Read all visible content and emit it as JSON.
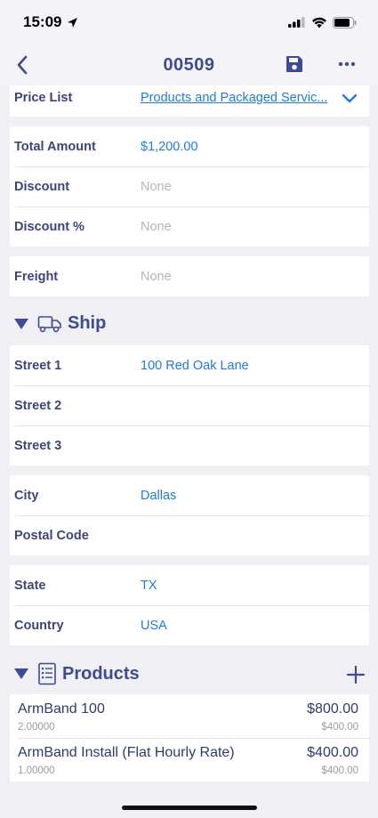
{
  "status_bar": {
    "time": "15:09"
  },
  "nav": {
    "title": "00509"
  },
  "price_list": {
    "label": "Price List",
    "value": "Products and Packaged Servic..."
  },
  "totals": [
    {
      "label": "Total Amount",
      "value": "$1,200.00",
      "empty": false
    },
    {
      "label": "Discount",
      "value": "None",
      "empty": true
    },
    {
      "label": "Discount %",
      "value": "None",
      "empty": true
    }
  ],
  "freight": {
    "label": "Freight",
    "value": "None"
  },
  "ship_section": {
    "title": "Ship"
  },
  "street": [
    {
      "label": "Street 1",
      "value": "100 Red Oak Lane"
    },
    {
      "label": "Street 2",
      "value": ""
    },
    {
      "label": "Street 3",
      "value": ""
    }
  ],
  "city_group": [
    {
      "label": "City",
      "value": "Dallas"
    },
    {
      "label": "Postal Code",
      "value": ""
    }
  ],
  "state_group": [
    {
      "label": "State",
      "value": "TX"
    },
    {
      "label": "Country",
      "value": "USA"
    }
  ],
  "products_section": {
    "title": "Products"
  },
  "products": [
    {
      "name": "ArmBand 100",
      "quantity": "2.00000",
      "total": "$800.00",
      "unit_price": "$400.00"
    },
    {
      "name": "ArmBand Install (Flat Hourly Rate)",
      "quantity": "1.00000",
      "total": "$400.00",
      "unit_price": "$400.00"
    }
  ],
  "colors": {
    "accent": "#3d4c92",
    "link": "#1f7ad9",
    "background": "#efeff4",
    "placeholder": "#b5b5bb"
  },
  "icons": {
    "back": "chevron-left-icon",
    "save": "floppy-disk-icon",
    "more": "ellipsis-icon",
    "ship": "truck-icon",
    "products": "list-document-icon",
    "add": "plus-icon"
  }
}
